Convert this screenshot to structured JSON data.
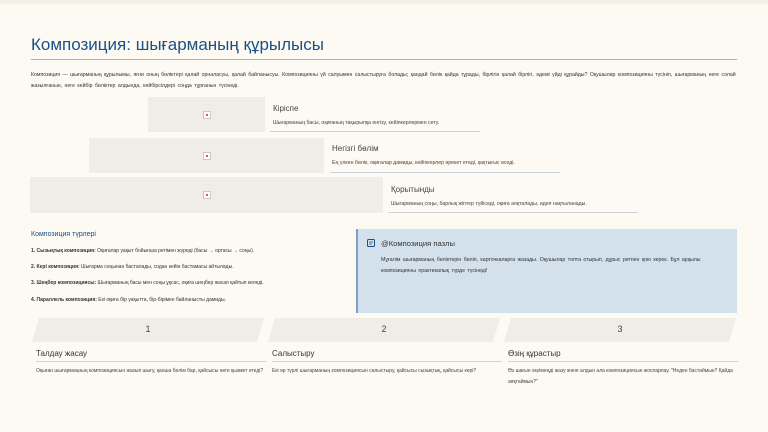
{
  "title": "Композиция: шығарманың құрылысы",
  "intro": "Композиция — шығарманың құрылымы, яғни оның бөліктері қалай орналасуы, қалай байланысуы. Композицияны үй салуымен салыстыруға болады; қандай бөлік қайда тұрады, бірлігін қалай бірлігі, әдемі үйді құрайды? Оқушылар композицияны түсініп, шығарманың неге солай жазылғанын, неге кейбір бөліктер алдында, кейбірсілдері соңда тұрғанын түсінеді.",
  "steps": [
    {
      "title": "Кіріспе",
      "desc": "Шығарманың басы, оқиғаның тақырыпқа енгізу, кейіпкерлермен сету."
    },
    {
      "title": "Негізгі бөлім",
      "desc": "Ең үлкен бөлік, оқиғалар дамиды, кейіпкерлер әрекет етеді, қақтығыс өседі."
    },
    {
      "title": "Қорытынды",
      "desc": "Шығарманың соңы, барлық жіптер түйіседі, оқиға аяқталады, идея нақтыланады."
    }
  ],
  "types": {
    "heading": "Композиция түрлері",
    "items": [
      {
        "label": "1. Сызықтық композиция:",
        "text": " Оқиғалар уақыт бойынша ретімен жүреді (басы → ортасы → соңы)."
      },
      {
        "label": "2. Кері композиция:",
        "text": " Шығарма соңынан басталады, содан кейін бастамасы айтылады."
      },
      {
        "label": "3. Шеңбер композициясы:",
        "text": " Шығарманың басы мен соңы ұқсас, оқиға шеңбер жасап қайтып келеді."
      },
      {
        "label": "4. Параллель композиция:",
        "text": " Екі оқиға бір уақытта, бір-бірімен байланысты дамиды."
      }
    ]
  },
  "callout": {
    "icon": "note-icon",
    "title": "@Композиция пазлы",
    "text": "Мұғалім шығарманың бөліктерін бөліп, карточкаларға жазады. Оқушылар топта отырып, дұрыс ретпен қою керек. Бұл арқылы композицияны практикалық түрде түсінеді!"
  },
  "activities": [
    {
      "num": "1",
      "title": "Талдау жасау",
      "desc": "Оқыған шығармаңның композициясын жазып шығу, қанша бөлім бар, қайсысы неге қызмет етеді?"
    },
    {
      "num": "2",
      "title": "Салыстыру",
      "desc": "Екі әр түрлі шығарманың композициясын салыстыру, қайсысы сызықтық, қайсысы кері?"
    },
    {
      "num": "3",
      "title": "Өзің құрастыр",
      "desc": "Өз шағын әңгімеңді жазу және алдын ала композициясын жоспарлау. \"Неден бастаймын? Қайда аяқтаймын?\""
    }
  ]
}
